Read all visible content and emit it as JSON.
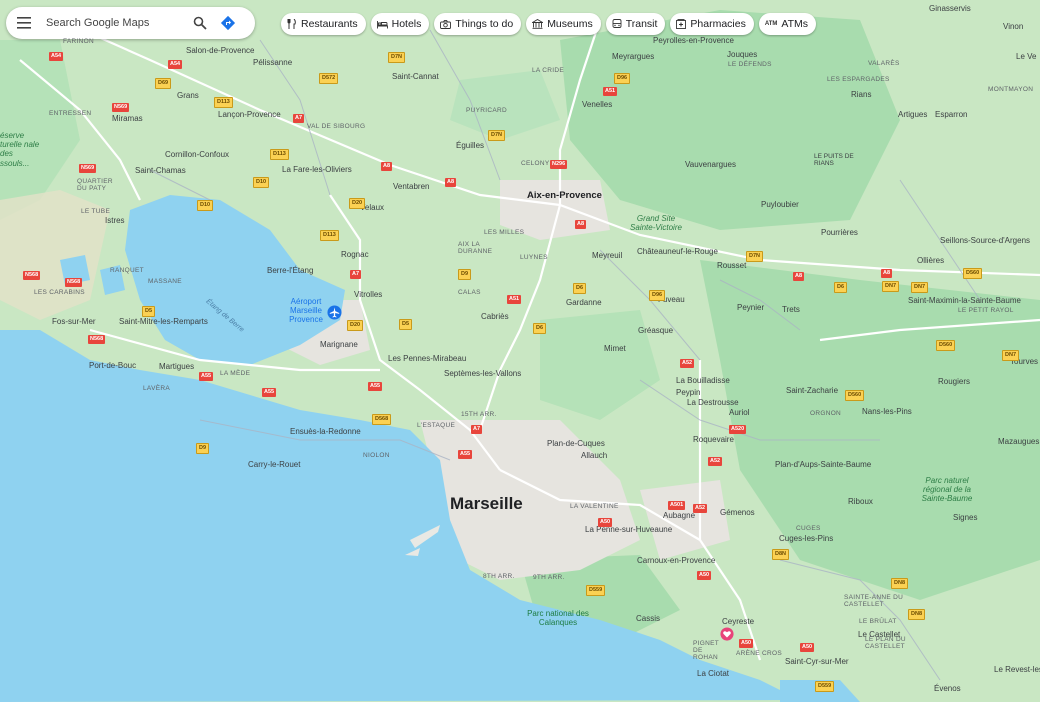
{
  "search": {
    "placeholder": "Search Google Maps"
  },
  "chips": [
    {
      "label": "Restaurants",
      "icon": "fork-knife-icon"
    },
    {
      "label": "Hotels",
      "icon": "bed-icon"
    },
    {
      "label": "Things to do",
      "icon": "camera-icon"
    },
    {
      "label": "Museums",
      "icon": "museum-icon"
    },
    {
      "label": "Transit",
      "icon": "bus-icon"
    },
    {
      "label": "Pharmacies",
      "icon": "pharmacy-icon"
    },
    {
      "label": "ATMs",
      "icon": "atm-icon",
      "tag": "ATM"
    }
  ],
  "colors": {
    "water": "#8fd2f0",
    "land": "#c9e7c3",
    "forest": "#a8dcae",
    "urban": "#e8e8e2",
    "major_road": "#ffffff",
    "accent": "#1a73e8"
  },
  "labels": {
    "marseille": "Marseille",
    "aix": "Aix-en-Provence",
    "airport": "Aéroport Marseille Provence",
    "parc_calanques": "Parc national des Calanques",
    "grand_site": "Grand Site Sainte-Victoire",
    "parc_sainte_baume": "Parc naturel régional de la Sainte-Baume",
    "reserve": "éserve turelle nale des ssouls...",
    "etang_berre": "Étang de Berre",
    "towns": [
      "Salon-de-Provence",
      "Pélissanne",
      "Saint-Cannat",
      "Meyrargues",
      "Peyrolles-en-Provence",
      "Jouques",
      "Grans",
      "Miramas",
      "Lançon-Provence",
      "Éguilles",
      "Venelles",
      "Cornillon-Confoux",
      "Saint-Chamas",
      "La Fare-les-Oliviers",
      "Ventabren",
      "Velaux",
      "Istres",
      "Berre-l'Étang",
      "Rognac",
      "Vitrolles",
      "Fos-sur-Mer",
      "Saint-Mitre-les-Remparts",
      "Port-de-Bouc",
      "Martigues",
      "Marignane",
      "Les Pennes-Mirabeau",
      "Septèmes-les-Vallons",
      "Cabriès",
      "Gardanne",
      "Meyreuil",
      "Fuveau",
      "Châteauneuf-le-Rouge",
      "Rousset",
      "Peynier",
      "Trets",
      "Vauvenargues",
      "Puyloubier",
      "Pourrières",
      "Rians",
      "Artigues",
      "Esparron",
      "Ollières",
      "Seillons-Source-d'Argens",
      "Saint-Maximin-la-Sainte-Baume",
      "Tourves",
      "Rougiers",
      "Saint-Zacharie",
      "Nans-les-Pins",
      "Mazaugues",
      "Plan-d'Aups-Sainte-Baume",
      "Riboux",
      "Signes",
      "Gémenos",
      "Cuges-les-Pins",
      "Aubagne",
      "La Penne-sur-Huveaune",
      "Carnoux-en-Provence",
      "Cassis",
      "Ceyreste",
      "La Ciotat",
      "Saint-Cyr-sur-Mer",
      "Le Castellet",
      "Évenos",
      "Le Revest-les",
      "Allauch",
      "Plan-de-Cuques",
      "Roquevaire",
      "Auriol",
      "La Destrousse",
      "Peypin",
      "La Bouilladisse",
      "Mimet",
      "Gréasque",
      "Carry-le-Rouet",
      "Ensuès-la-Redonne",
      "Ginasservis",
      "Vinon",
      "Le Ve",
      "Le Puits de Rians"
    ],
    "small": [
      "FARINON",
      "ENTRESSEN",
      "QUARTIER DU PATY",
      "LE TUBE",
      "RANQUET",
      "MASSANE",
      "LES CARABINS",
      "LAVÈRA",
      "LA MÈDE",
      "VAL DE SIBOURG",
      "PUYRICARD",
      "CELONY",
      "LES MILLES",
      "AIX LA DURANNE",
      "LUYNES",
      "CALAS",
      "LA CRIDE",
      "LE DÉFENDS",
      "LES ESPARGADES",
      "VALARÈS",
      "MONTMAYON",
      "LE PETIT RAYOL",
      "ORGNON",
      "LA VALENTINE",
      "15TH ARR.",
      "8TH ARR.",
      "9TH ARR.",
      "L'ESTAQUE",
      "NIOLON",
      "CUGES",
      "SAINTE-ANNE DU CASTELLET",
      "LE BRÛLAT",
      "LE PLAN DU CASTELLET",
      "PIGNET DE ROHAN",
      "ARÈNE CROS",
      "LE PUITS DE RIANS"
    ]
  }
}
